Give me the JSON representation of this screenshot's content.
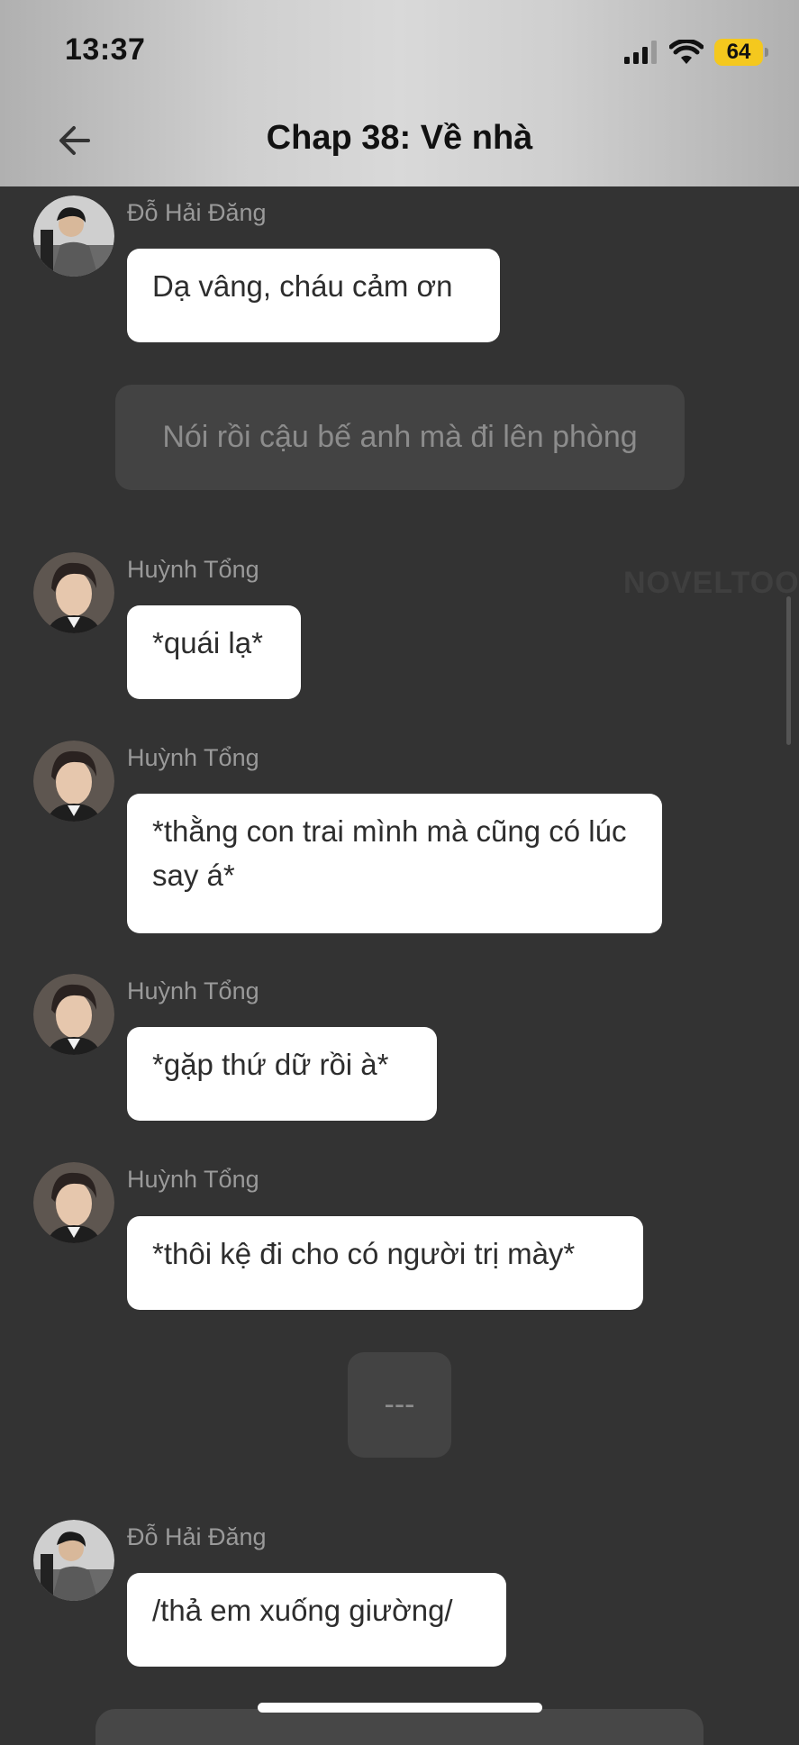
{
  "status_bar": {
    "time": "13:37",
    "battery": "64"
  },
  "header": {
    "title": "Chap 38: Về nhà"
  },
  "watermark": "NOVELTOON",
  "messages": [
    {
      "speaker": "Đỗ Hải Đăng",
      "text": "Dạ vâng, cháu cảm ơn"
    },
    {
      "narration": "Nói rồi cậu bế anh mà đi lên phòng"
    },
    {
      "speaker": "Huỳnh Tổng",
      "text": "*quái lạ*"
    },
    {
      "speaker": "Huỳnh Tổng",
      "text": "*thằng con trai mình mà cũng có lúc say á*"
    },
    {
      "speaker": "Huỳnh Tổng",
      "text": "*gặp thứ dữ rồi à*"
    },
    {
      "speaker": "Huỳnh Tổng",
      "text": "*thôi kệ đi cho có người trị mày*"
    },
    {
      "narration": "---"
    },
    {
      "speaker": "Đỗ Hải Đăng",
      "text": "/thả em xuống giường/"
    }
  ]
}
